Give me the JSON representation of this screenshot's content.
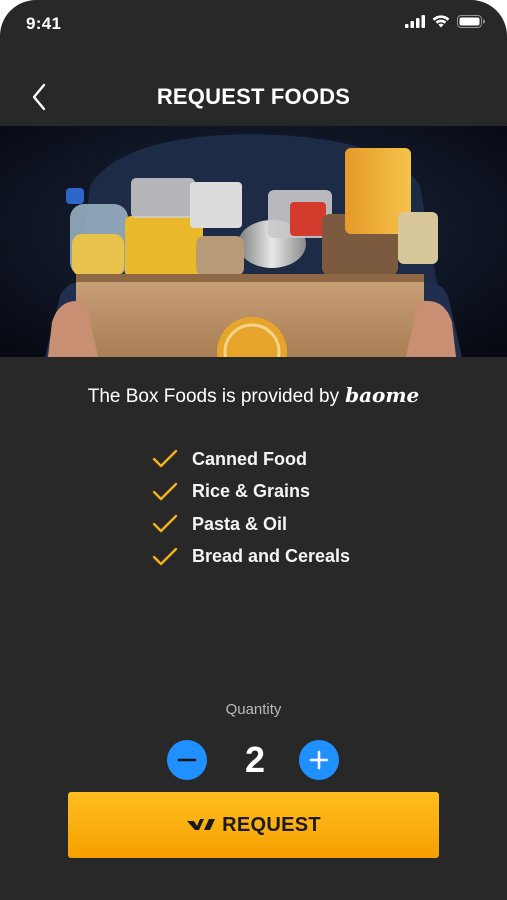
{
  "status_bar": {
    "time": "9:41",
    "signal_icon": "signal-bars-icon",
    "wifi_icon": "wifi-icon",
    "battery_icon": "battery-icon"
  },
  "header": {
    "title": "REQUEST FOODS",
    "back_icon": "chevron-left-icon"
  },
  "hero": {
    "image": "food-donation-box-photo"
  },
  "provider": {
    "text": "The Box Foods is provided by",
    "brand": "baome"
  },
  "contents": {
    "items": [
      {
        "label": "Canned Food"
      },
      {
        "label": "Rice & Grains"
      },
      {
        "label": "Pasta & Oil"
      },
      {
        "label": "Bread and Cereals"
      }
    ],
    "check_color": "#f5b31b"
  },
  "quantity": {
    "label": "Quantity",
    "value": "2",
    "minus_icon": "minus-icon",
    "plus_icon": "plus-icon",
    "button_color": "#1e90ff"
  },
  "request_button": {
    "label": "REQUEST",
    "icon": "brand-logo-icon",
    "color": "#f5a800"
  },
  "colors": {
    "background": "#282828",
    "accent": "#f5a800"
  }
}
